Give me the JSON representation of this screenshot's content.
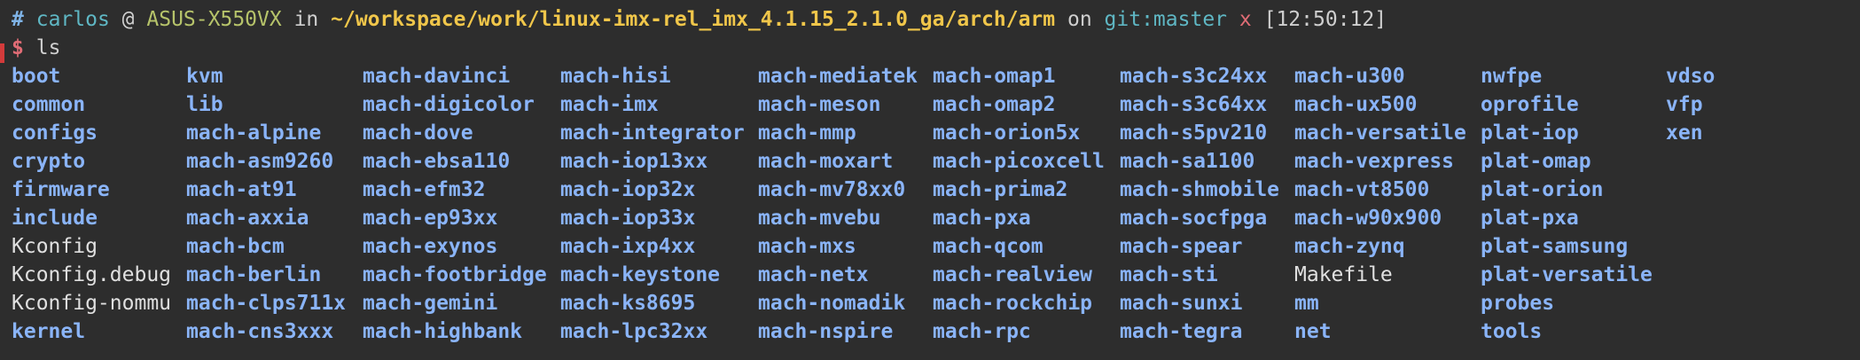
{
  "prompt": {
    "hash": "#",
    "user": "carlos",
    "at": "@",
    "host": "ASUS-X550VX",
    "in": "in",
    "path": "~/workspace/work/linux-imx-rel_imx_4.1.15_2.1.0_ga/arch/arm",
    "on": "on",
    "git": "git:master",
    "dirty": "x",
    "time": "[12:50:12]"
  },
  "command": {
    "symbol": "$",
    "text": "ls"
  },
  "colors": {
    "background": "#2d2d2d",
    "directory": "#8ab4f8",
    "file": "#e0e0e0",
    "path": "#f0c64a",
    "host": "#b6c36a",
    "user": "#5fb7c4",
    "dirty": "#e06c75"
  },
  "columns": [
    [
      {
        "name": "boot",
        "type": "dir"
      },
      {
        "name": "common",
        "type": "dir"
      },
      {
        "name": "configs",
        "type": "dir"
      },
      {
        "name": "crypto",
        "type": "dir"
      },
      {
        "name": "firmware",
        "type": "dir"
      },
      {
        "name": "include",
        "type": "dir"
      },
      {
        "name": "Kconfig",
        "type": "file"
      },
      {
        "name": "Kconfig.debug",
        "type": "file"
      },
      {
        "name": "Kconfig-nommu",
        "type": "file"
      },
      {
        "name": "kernel",
        "type": "dir"
      }
    ],
    [
      {
        "name": "kvm",
        "type": "dir"
      },
      {
        "name": "lib",
        "type": "dir"
      },
      {
        "name": "mach-alpine",
        "type": "dir"
      },
      {
        "name": "mach-asm9260",
        "type": "dir"
      },
      {
        "name": "mach-at91",
        "type": "dir"
      },
      {
        "name": "mach-axxia",
        "type": "dir"
      },
      {
        "name": "mach-bcm",
        "type": "dir"
      },
      {
        "name": "mach-berlin",
        "type": "dir"
      },
      {
        "name": "mach-clps711x",
        "type": "dir"
      },
      {
        "name": "mach-cns3xxx",
        "type": "dir"
      }
    ],
    [
      {
        "name": "mach-davinci",
        "type": "dir"
      },
      {
        "name": "mach-digicolor",
        "type": "dir"
      },
      {
        "name": "mach-dove",
        "type": "dir"
      },
      {
        "name": "mach-ebsa110",
        "type": "dir"
      },
      {
        "name": "mach-efm32",
        "type": "dir"
      },
      {
        "name": "mach-ep93xx",
        "type": "dir"
      },
      {
        "name": "mach-exynos",
        "type": "dir"
      },
      {
        "name": "mach-footbridge",
        "type": "dir"
      },
      {
        "name": "mach-gemini",
        "type": "dir"
      },
      {
        "name": "mach-highbank",
        "type": "dir"
      }
    ],
    [
      {
        "name": "mach-hisi",
        "type": "dir"
      },
      {
        "name": "mach-imx",
        "type": "dir"
      },
      {
        "name": "mach-integrator",
        "type": "dir"
      },
      {
        "name": "mach-iop13xx",
        "type": "dir"
      },
      {
        "name": "mach-iop32x",
        "type": "dir"
      },
      {
        "name": "mach-iop33x",
        "type": "dir"
      },
      {
        "name": "mach-ixp4xx",
        "type": "dir"
      },
      {
        "name": "mach-keystone",
        "type": "dir"
      },
      {
        "name": "mach-ks8695",
        "type": "dir"
      },
      {
        "name": "mach-lpc32xx",
        "type": "dir"
      }
    ],
    [
      {
        "name": "mach-mediatek",
        "type": "dir"
      },
      {
        "name": "mach-meson",
        "type": "dir"
      },
      {
        "name": "mach-mmp",
        "type": "dir"
      },
      {
        "name": "mach-moxart",
        "type": "dir"
      },
      {
        "name": "mach-mv78xx0",
        "type": "dir"
      },
      {
        "name": "mach-mvebu",
        "type": "dir"
      },
      {
        "name": "mach-mxs",
        "type": "dir"
      },
      {
        "name": "mach-netx",
        "type": "dir"
      },
      {
        "name": "mach-nomadik",
        "type": "dir"
      },
      {
        "name": "mach-nspire",
        "type": "dir"
      }
    ],
    [
      {
        "name": "mach-omap1",
        "type": "dir"
      },
      {
        "name": "mach-omap2",
        "type": "dir"
      },
      {
        "name": "mach-orion5x",
        "type": "dir"
      },
      {
        "name": "mach-picoxcell",
        "type": "dir"
      },
      {
        "name": "mach-prima2",
        "type": "dir"
      },
      {
        "name": "mach-pxa",
        "type": "dir"
      },
      {
        "name": "mach-qcom",
        "type": "dir"
      },
      {
        "name": "mach-realview",
        "type": "dir"
      },
      {
        "name": "mach-rockchip",
        "type": "dir"
      },
      {
        "name": "mach-rpc",
        "type": "dir"
      }
    ],
    [
      {
        "name": "mach-s3c24xx",
        "type": "dir"
      },
      {
        "name": "mach-s3c64xx",
        "type": "dir"
      },
      {
        "name": "mach-s5pv210",
        "type": "dir"
      },
      {
        "name": "mach-sa1100",
        "type": "dir"
      },
      {
        "name": "mach-shmobile",
        "type": "dir"
      },
      {
        "name": "mach-socfpga",
        "type": "dir"
      },
      {
        "name": "mach-spear",
        "type": "dir"
      },
      {
        "name": "mach-sti",
        "type": "dir"
      },
      {
        "name": "mach-sunxi",
        "type": "dir"
      },
      {
        "name": "mach-tegra",
        "type": "dir"
      }
    ],
    [
      {
        "name": "mach-u300",
        "type": "dir"
      },
      {
        "name": "mach-ux500",
        "type": "dir"
      },
      {
        "name": "mach-versatile",
        "type": "dir"
      },
      {
        "name": "mach-vexpress",
        "type": "dir"
      },
      {
        "name": "mach-vt8500",
        "type": "dir"
      },
      {
        "name": "mach-w90x900",
        "type": "dir"
      },
      {
        "name": "mach-zynq",
        "type": "dir"
      },
      {
        "name": "Makefile",
        "type": "file"
      },
      {
        "name": "mm",
        "type": "dir"
      },
      {
        "name": "net",
        "type": "dir"
      }
    ],
    [
      {
        "name": "nwfpe",
        "type": "dir"
      },
      {
        "name": "oprofile",
        "type": "dir"
      },
      {
        "name": "plat-iop",
        "type": "dir"
      },
      {
        "name": "plat-omap",
        "type": "dir"
      },
      {
        "name": "plat-orion",
        "type": "dir"
      },
      {
        "name": "plat-pxa",
        "type": "dir"
      },
      {
        "name": "plat-samsung",
        "type": "dir"
      },
      {
        "name": "plat-versatile",
        "type": "dir"
      },
      {
        "name": "probes",
        "type": "dir"
      },
      {
        "name": "tools",
        "type": "dir"
      }
    ],
    [
      {
        "name": "vdso",
        "type": "dir"
      },
      {
        "name": "vfp",
        "type": "dir"
      },
      {
        "name": "xen",
        "type": "dir"
      }
    ]
  ]
}
